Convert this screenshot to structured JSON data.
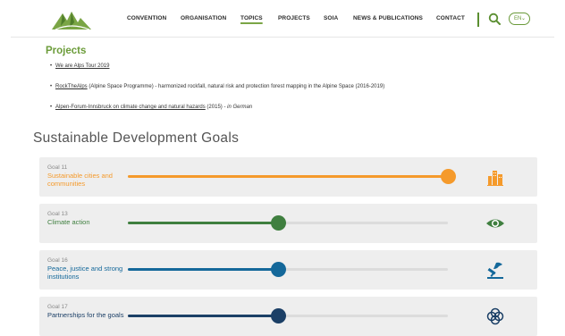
{
  "header": {
    "nav": [
      {
        "label": "CONVENTION",
        "active": false
      },
      {
        "label": "ORGANISATION",
        "active": false
      },
      {
        "label": "TOPICS",
        "active": true
      },
      {
        "label": "PROJECTS",
        "active": false
      },
      {
        "label": "SOIA",
        "active": false
      },
      {
        "label": "NEWS & PUBLICATIONS",
        "active": false
      },
      {
        "label": "CONTACT",
        "active": false
      }
    ],
    "language": "EN",
    "search_icon": "search-icon"
  },
  "projects": {
    "title": "Projects",
    "items": [
      {
        "link": "We are Alps Tour 2019",
        "rest": "",
        "italic": ""
      },
      {
        "link": "RockTheAlps",
        "rest": " (Alpine Space Programme) - harmonized rockfall, natural risk and protection forest mapping in the Alpine Space (2016-2019)",
        "italic": ""
      },
      {
        "link": "Alpen-Forum-Innsbruck on climate change and natural hazards",
        "rest": " (2015) - ",
        "italic": "in German"
      }
    ]
  },
  "sdg": {
    "title": "Sustainable Development Goals",
    "goals": [
      {
        "num": "Goal 11",
        "name": "Sustainable cities and communities",
        "color": "#f59a2b",
        "level": 1.0,
        "icon": "city-icon"
      },
      {
        "num": "Goal 13",
        "name": "Climate action",
        "color": "#3f7f3f",
        "level": 0.47,
        "icon": "eye-globe-icon"
      },
      {
        "num": "Goal 16",
        "name": "Peace, justice and strong institutions",
        "color": "#14689a",
        "level": 0.47,
        "icon": "dove-gavel-icon"
      },
      {
        "num": "Goal 17",
        "name": "Partnerships for the goals",
        "color": "#1b3f66",
        "level": 0.47,
        "icon": "rings-icon"
      }
    ]
  }
}
